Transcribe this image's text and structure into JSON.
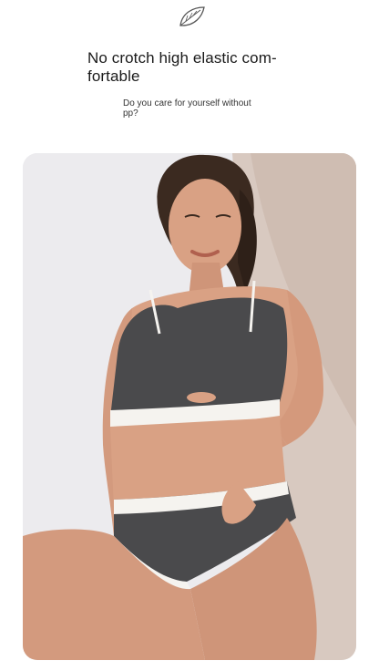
{
  "header": {
    "icon": "leaf-icon",
    "title": "No crotch high elastic com-\nfortable",
    "subtitle": "Do you care for yourself without pp?"
  },
  "photo": {
    "subject": "model-photo",
    "colors": {
      "background": "#ecebee",
      "backdrop_accent": "#d8c9c0",
      "garment": "#4a4a4c",
      "trim": "#f5f3ef",
      "skin": "#d9a184",
      "hair": "#3b2a20"
    }
  }
}
